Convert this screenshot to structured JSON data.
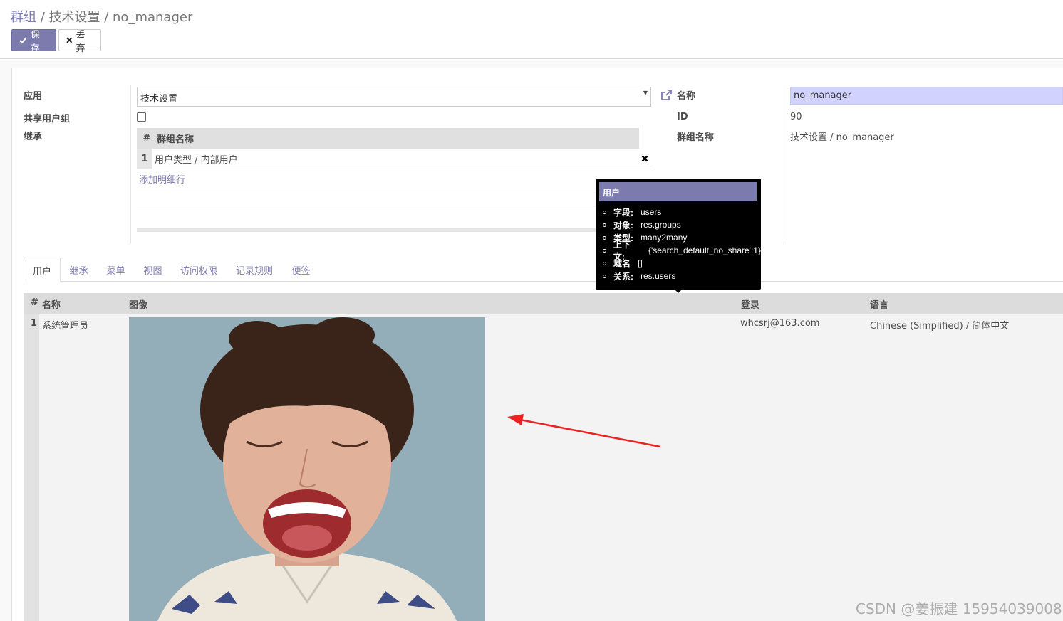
{
  "breadcrumb": {
    "parent": "群组",
    "sep": " / ",
    "current": "技术设置 / no_manager"
  },
  "toolbar": {
    "save_label": "保存",
    "discard_label": "丢弃"
  },
  "form": {
    "app_label": "应用",
    "app_value": "技术设置",
    "shared_label": "共享用户组",
    "inherit_label": "继承",
    "inherit_table": {
      "col_num": "#",
      "col_name": "群组名称",
      "rows": [
        {
          "idx": "1",
          "name": "用户类型 / 内部用户"
        }
      ]
    },
    "add_line": "添加明细行",
    "name_label": "名称",
    "name_value": "no_manager",
    "id_label": "ID",
    "id_value": "90",
    "group_name_label": "群组名称",
    "group_name_value": "技术设置 / no_manager"
  },
  "tabs": [
    "用户",
    "继承",
    "菜单",
    "视图",
    "访问权限",
    "记录规则",
    "便签"
  ],
  "users_table": {
    "headers": {
      "num": "#",
      "name": "名称",
      "image": "图像",
      "login": "登录",
      "lang": "语言"
    },
    "rows": [
      {
        "idx": "1",
        "name": "系统管理员",
        "login": "whcsrj@163.com",
        "lang": "Chinese (Simplified) / 简体中文"
      }
    ]
  },
  "tooltip": {
    "title": "用户",
    "items": [
      {
        "key": "字段:",
        "value": "users"
      },
      {
        "key": "对象:",
        "value": "res.groups"
      },
      {
        "key": "类型:",
        "value": "many2many"
      },
      {
        "key": "上下文:",
        "value": "{'search_default_no_share':1}"
      },
      {
        "key": "域名",
        "value": "[]"
      },
      {
        "key": "关系:",
        "value": "res.users"
      }
    ]
  },
  "watermark": "CSDN @姜振建  15954039008",
  "colors": {
    "accent": "#7c7bad",
    "name_bg": "#d2d2ff",
    "annotation_arrow": "#ee2222"
  }
}
